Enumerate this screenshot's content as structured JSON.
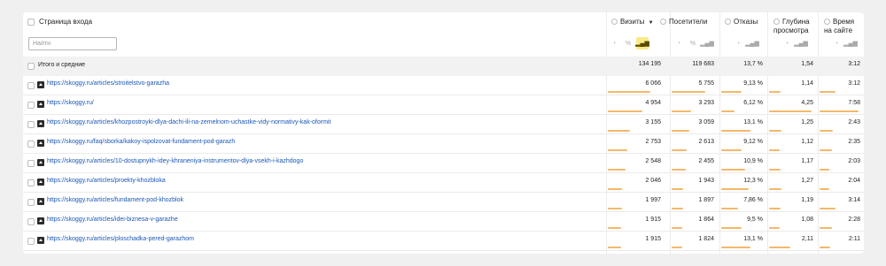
{
  "header": {
    "dimension_label": "Страница входа",
    "search_placeholder": "Найти",
    "sort_indicator": "▼",
    "columns": [
      {
        "label": "Визиты"
      },
      {
        "label": "Посетители"
      },
      {
        "label": "Отказы"
      },
      {
        "label_line1": "Глубина",
        "label_line2": "просмотра"
      },
      {
        "label_line1": "Время",
        "label_line2": "на сайте"
      }
    ],
    "view_icons": [
      "pie-chart-icon",
      "percent-icon",
      "bar-chart-icon"
    ]
  },
  "totals": {
    "label": "Итого и средние",
    "visits": "134 195",
    "visitors": "119 683",
    "bounce": "13,7 %",
    "depth": "1,54",
    "time": "3:12"
  },
  "rows": [
    {
      "url": "https://skoggy.ru/articles/stroitelstvo-garazha",
      "visits": "6 066",
      "visitors": "5 755",
      "bounce": "9,13 %",
      "depth": "1,14",
      "time": "3:12",
      "bar_visits": 1.0,
      "bar_visitors": 1.0,
      "bar_bounce": 0.67,
      "bar_depth": 0.27,
      "bar_time": 0.42
    },
    {
      "url": "https://skoggy.ru/",
      "visits": "4 954",
      "visitors": "3 293",
      "bounce": "6,12 %",
      "depth": "4,25",
      "time": "7:58",
      "bar_visits": 0.82,
      "bar_visitors": 0.57,
      "bar_bounce": 0.45,
      "bar_depth": 1.0,
      "bar_time": 1.0
    },
    {
      "url": "https://skoggy.ru/articles/khozpostroyki-dlya-dachi-ili-na-zemelnom-uchastke-vidy-normativy-kak-oformit",
      "visits": "3 155",
      "visitors": "3 059",
      "bounce": "13,1 %",
      "depth": "1,25",
      "time": "2:43",
      "bar_visits": 0.52,
      "bar_visitors": 0.53,
      "bar_bounce": 0.96,
      "bar_depth": 0.29,
      "bar_time": 0.34
    },
    {
      "url": "https://skoggy.ru/faq/sborka/kakoy-ispolzovat-fundament-pod-garazh",
      "visits": "2 753",
      "visitors": "2 613",
      "bounce": "9,12 %",
      "depth": "1,12",
      "time": "2:35",
      "bar_visits": 0.45,
      "bar_visitors": 0.45,
      "bar_bounce": 0.67,
      "bar_depth": 0.26,
      "bar_time": 0.32
    },
    {
      "url": "https://skoggy.ru/articles/10-dostupnykh-idey-khraneniya-instrumentov-dlya-vsekh-i-kazhdogo",
      "visits": "2 548",
      "visitors": "2 455",
      "bounce": "10,9 %",
      "depth": "1,17",
      "time": "2:03",
      "bar_visits": 0.42,
      "bar_visitors": 0.43,
      "bar_bounce": 0.8,
      "bar_depth": 0.28,
      "bar_time": 0.26
    },
    {
      "url": "https://skoggy.ru/articles/proekty-khozbloka",
      "visits": "2 046",
      "visitors": "1 943",
      "bounce": "12,3 %",
      "depth": "1,27",
      "time": "2:04",
      "bar_visits": 0.34,
      "bar_visitors": 0.34,
      "bar_bounce": 0.9,
      "bar_depth": 0.3,
      "bar_time": 0.26
    },
    {
      "url": "https://skoggy.ru/articles/fundament-pod-khozblok",
      "visits": "1 997",
      "visitors": "1 897",
      "bounce": "7,86 %",
      "depth": "1,19",
      "time": "3:14",
      "bar_visits": 0.33,
      "bar_visitors": 0.33,
      "bar_bounce": 0.57,
      "bar_depth": 0.28,
      "bar_time": 0.4
    },
    {
      "url": "https://skoggy.ru/articles/idei-biznesa-v-garazhe",
      "visits": "1 915",
      "visitors": "1 864",
      "bounce": "9,5 %",
      "depth": "1,08",
      "time": "2:28",
      "bar_visits": 0.32,
      "bar_visitors": 0.32,
      "bar_bounce": 0.69,
      "bar_depth": 0.25,
      "bar_time": 0.31
    },
    {
      "url": "https://skoggy.ru/articles/ploschadka-pered-garazhom",
      "visits": "1 915",
      "visitors": "1 824",
      "bounce": "13,1 %",
      "depth": "2,11",
      "time": "2:11",
      "bar_visits": 0.32,
      "bar_visitors": 0.32,
      "bar_bounce": 0.96,
      "bar_depth": 0.5,
      "bar_time": 0.27
    }
  ],
  "colors": {
    "bar": "#f4b86a",
    "link": "#1a57b8",
    "active_view": "#fce98a"
  }
}
